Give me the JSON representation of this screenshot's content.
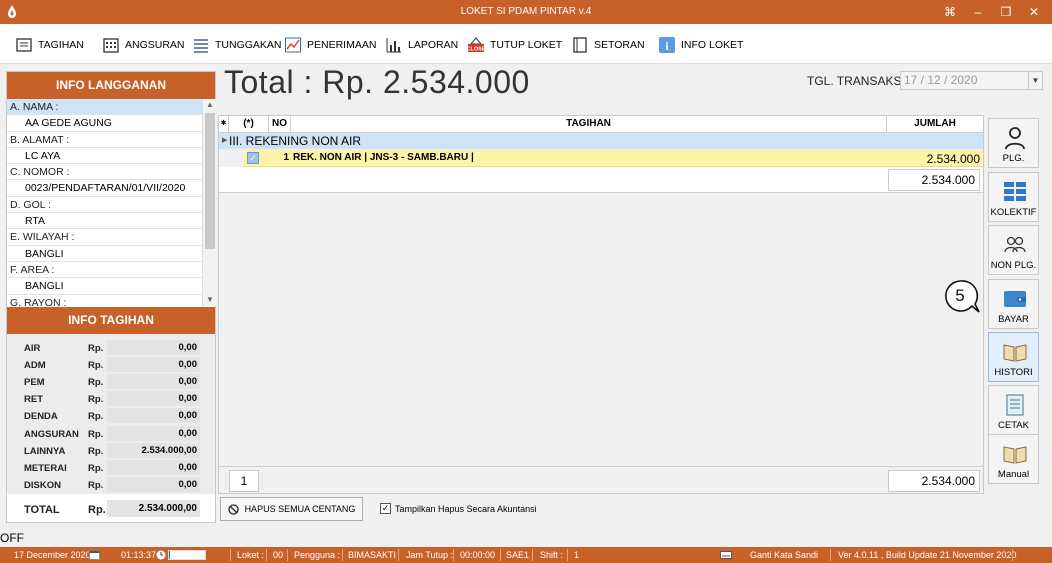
{
  "window": {
    "title": "LOKET SI PDAM PINTAR v.4",
    "buttons": [
      "⌘",
      "–",
      "❐",
      "✕"
    ]
  },
  "toolbar": [
    {
      "label": "TAGIHAN",
      "icon": "receipt-icon"
    },
    {
      "label": "ANGSURAN",
      "icon": "calendar-icon"
    },
    {
      "label": "TUNGGAKAN",
      "icon": "list-icon"
    },
    {
      "label": "PENERIMAAN",
      "icon": "chart-icon"
    },
    {
      "label": "LAPORAN",
      "icon": "bar-chart-icon"
    },
    {
      "label": "TUTUP LOKET",
      "icon": "close-sign-icon"
    },
    {
      "label": "SETORAN",
      "icon": "book-icon"
    },
    {
      "label": "INFO LOKET",
      "icon": "info-icon"
    }
  ],
  "info_langganan": {
    "header": "INFO LANGGANAN",
    "rows": [
      {
        "label": "A. NAMA :",
        "value": "AA GEDE AGUNG"
      },
      {
        "label": "B. ALAMAT :",
        "value": "LC AYA"
      },
      {
        "label": "C. NOMOR :",
        "value": "0023/PENDAFTARAN/01/VII/2020"
      },
      {
        "label": "D. GOL :",
        "value": "RTA"
      },
      {
        "label": "E. WILAYAH :",
        "value": "BANGLI"
      },
      {
        "label": "F. AREA :",
        "value": "BANGLI"
      },
      {
        "label": "G. RAYON :",
        "value": ""
      }
    ]
  },
  "info_tagihan": {
    "header": "INFO TAGIHAN",
    "currency": "Rp.",
    "items": [
      {
        "name": "AIR",
        "value": "0,00"
      },
      {
        "name": "ADM",
        "value": "0,00"
      },
      {
        "name": "PEM",
        "value": "0,00"
      },
      {
        "name": "RET",
        "value": "0,00"
      },
      {
        "name": "DENDA",
        "value": "0,00"
      },
      {
        "name": "ANGSURAN",
        "value": "0,00"
      },
      {
        "name": "LAINNYA",
        "value": "2.534.000,00"
      },
      {
        "name": "METERAI",
        "value": "0,00"
      },
      {
        "name": "DISKON",
        "value": "0,00"
      }
    ],
    "total_label": "TOTAL",
    "total_value": "2.534.000,00"
  },
  "header": {
    "total_text": "Total :  Rp. 2.534.000",
    "tgl_label": "TGL. TRANSAKSI",
    "tgl_value": "17 / 12 / 2020"
  },
  "grid": {
    "columns": {
      "mark": "(*)",
      "no": "NO",
      "tagihan": "TAGIHAN",
      "jumlah": "JUMLAH"
    },
    "group": "III. REKENING NON AIR",
    "rows": [
      {
        "checked": true,
        "no": "1",
        "tagihan": "REK. NON AIR | JNS-3  - SAMB.BARU |",
        "jumlah": "2.534.000"
      }
    ],
    "group_sum": "2.534.000",
    "footer_count": "1",
    "footer_sum": "2.534.000"
  },
  "actions": {
    "hapus_label": "HAPUS SEMUA CENTANG",
    "checkbox_label": "Tampilkan Hapus Secara Akuntansi",
    "checkbox_checked": true
  },
  "side_buttons": [
    {
      "label": "PLG.",
      "icon": "person-icon"
    },
    {
      "label": "KOLEKTIF",
      "icon": "grid-icon"
    },
    {
      "label": "NON PLG.",
      "icon": "people-icon"
    },
    {
      "label": "BAYAR",
      "icon": "wallet-icon"
    },
    {
      "label": "HISTORI",
      "icon": "open-book-icon"
    },
    {
      "label": "CETAK",
      "icon": "document-icon"
    },
    {
      "label": "Manual",
      "icon": "manual-book-icon"
    }
  ],
  "callout": {
    "number": "5"
  },
  "off_label": "OFF",
  "status": {
    "date": "17 December 2020",
    "time": "01:13:37",
    "progress_pct": 4,
    "progress_label": "4%",
    "loket_label": "Loket :",
    "loket_value": "00",
    "pengguna_label": "Pengguna :",
    "pengguna_value": "BIMASAKTI",
    "jam_tutup_label": "Jam Tutup :",
    "jam_tutup_value": "00:00:00",
    "code": "SAE1",
    "shift_label": "Shift :",
    "shift_value": "1",
    "ganti_sandi": "Ganti Kata Sandi",
    "version": "Ver 4.0.11 , Build Update 21 November 2020"
  },
  "colors": {
    "accent": "#c8602a",
    "selection": "#cfe3f6",
    "highlight_row": "#fdf4a8",
    "progress": "#2a76d2"
  }
}
